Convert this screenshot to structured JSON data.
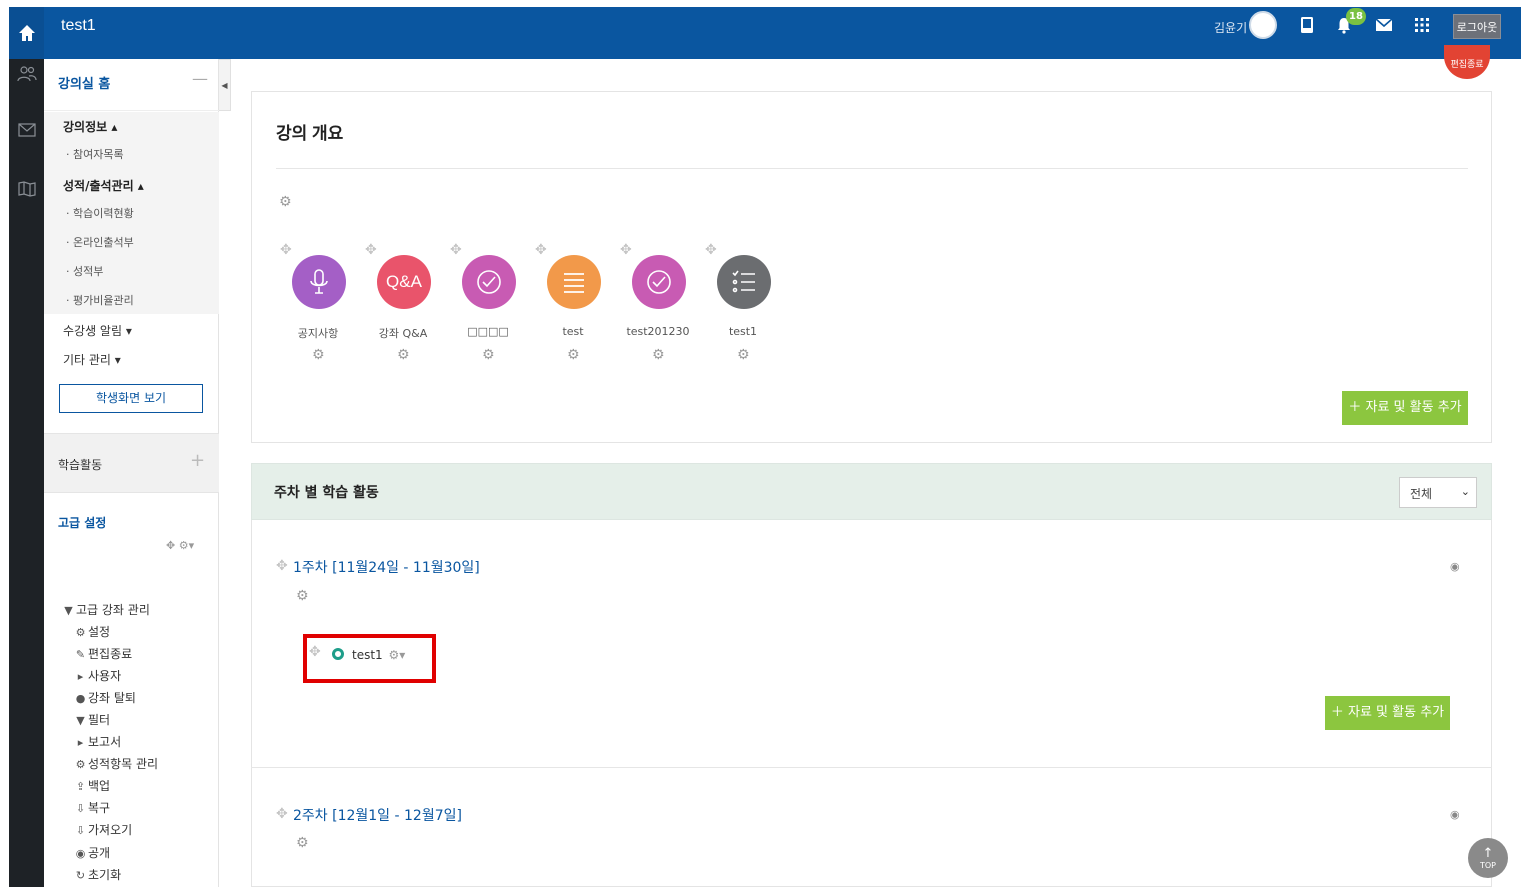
{
  "header": {
    "site_title": "test1",
    "user_name": "김윤기",
    "notification_count": "18",
    "logout_label": "로그아웃"
  },
  "sidebar": {
    "home_label": "강의실 홈",
    "course_info": {
      "title": "강의정보 ▴",
      "items": [
        "· 참여자목록"
      ]
    },
    "grade_attend": {
      "title": "성적/출석관리 ▴",
      "items": [
        "· 학습이력현황",
        "· 온라인출석부",
        "· 성적부",
        "· 평가비율관리"
      ]
    },
    "student_alert": "수강생 알림 ▾",
    "other_manage": "기타 관리 ▾",
    "student_view_label": "학생화면 보기",
    "activities_label": "학습활동",
    "advanced_title": "고급 설정",
    "tree": {
      "root": "고급 강좌 관리",
      "items": [
        "설정",
        "편집종료",
        "사용자",
        "강좌 탈퇴",
        "필터",
        "보고서",
        "성적항목 관리",
        "백업",
        "복구",
        "가져오기",
        "공개",
        "초기화"
      ]
    }
  },
  "main": {
    "edit_mode_label": "편집종료",
    "overview_title": "강의 개요",
    "modules": [
      {
        "label": "공지사항",
        "icon": "microphone-icon",
        "color": "#a45fc6"
      },
      {
        "label": "강좌 Q&A",
        "icon": "qna-icon",
        "text": "Q&A",
        "color": "#e9546b"
      },
      {
        "label": "□□□□",
        "icon": "check-circle-icon",
        "color": "#c85bb3"
      },
      {
        "label": "test",
        "icon": "list-icon",
        "color": "#f2994a"
      },
      {
        "label": "test201230",
        "icon": "check-circle-icon",
        "color": "#c85bb3"
      },
      {
        "label": "test1",
        "icon": "checklist-icon",
        "color": "#6b6d70"
      }
    ],
    "add_activity_label": "자료 및 활동 추가",
    "weekly_title": "주차 별 학습 활동",
    "filter_value": "전체",
    "week1_title": "1주차 [11월24일 - 11월30일]",
    "week1_activity": "test1",
    "week2_title": "2주차 [12월1일 - 12월7일]",
    "top_label": "TOP"
  }
}
